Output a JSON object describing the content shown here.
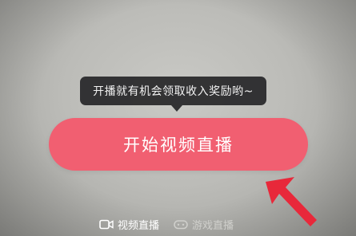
{
  "tooltip": {
    "text": "开播就有机会领取收入奖励哟~"
  },
  "main_button": {
    "label": "开始视频直播",
    "color": "#f15f71"
  },
  "annotation": {
    "icon": "red-arrow-icon",
    "color": "#e8283a"
  },
  "tabs": [
    {
      "label": "视频直播",
      "icon": "video-camera-icon",
      "active": true
    },
    {
      "label": "游戏直播",
      "icon": "gamepad-icon",
      "active": false
    }
  ]
}
